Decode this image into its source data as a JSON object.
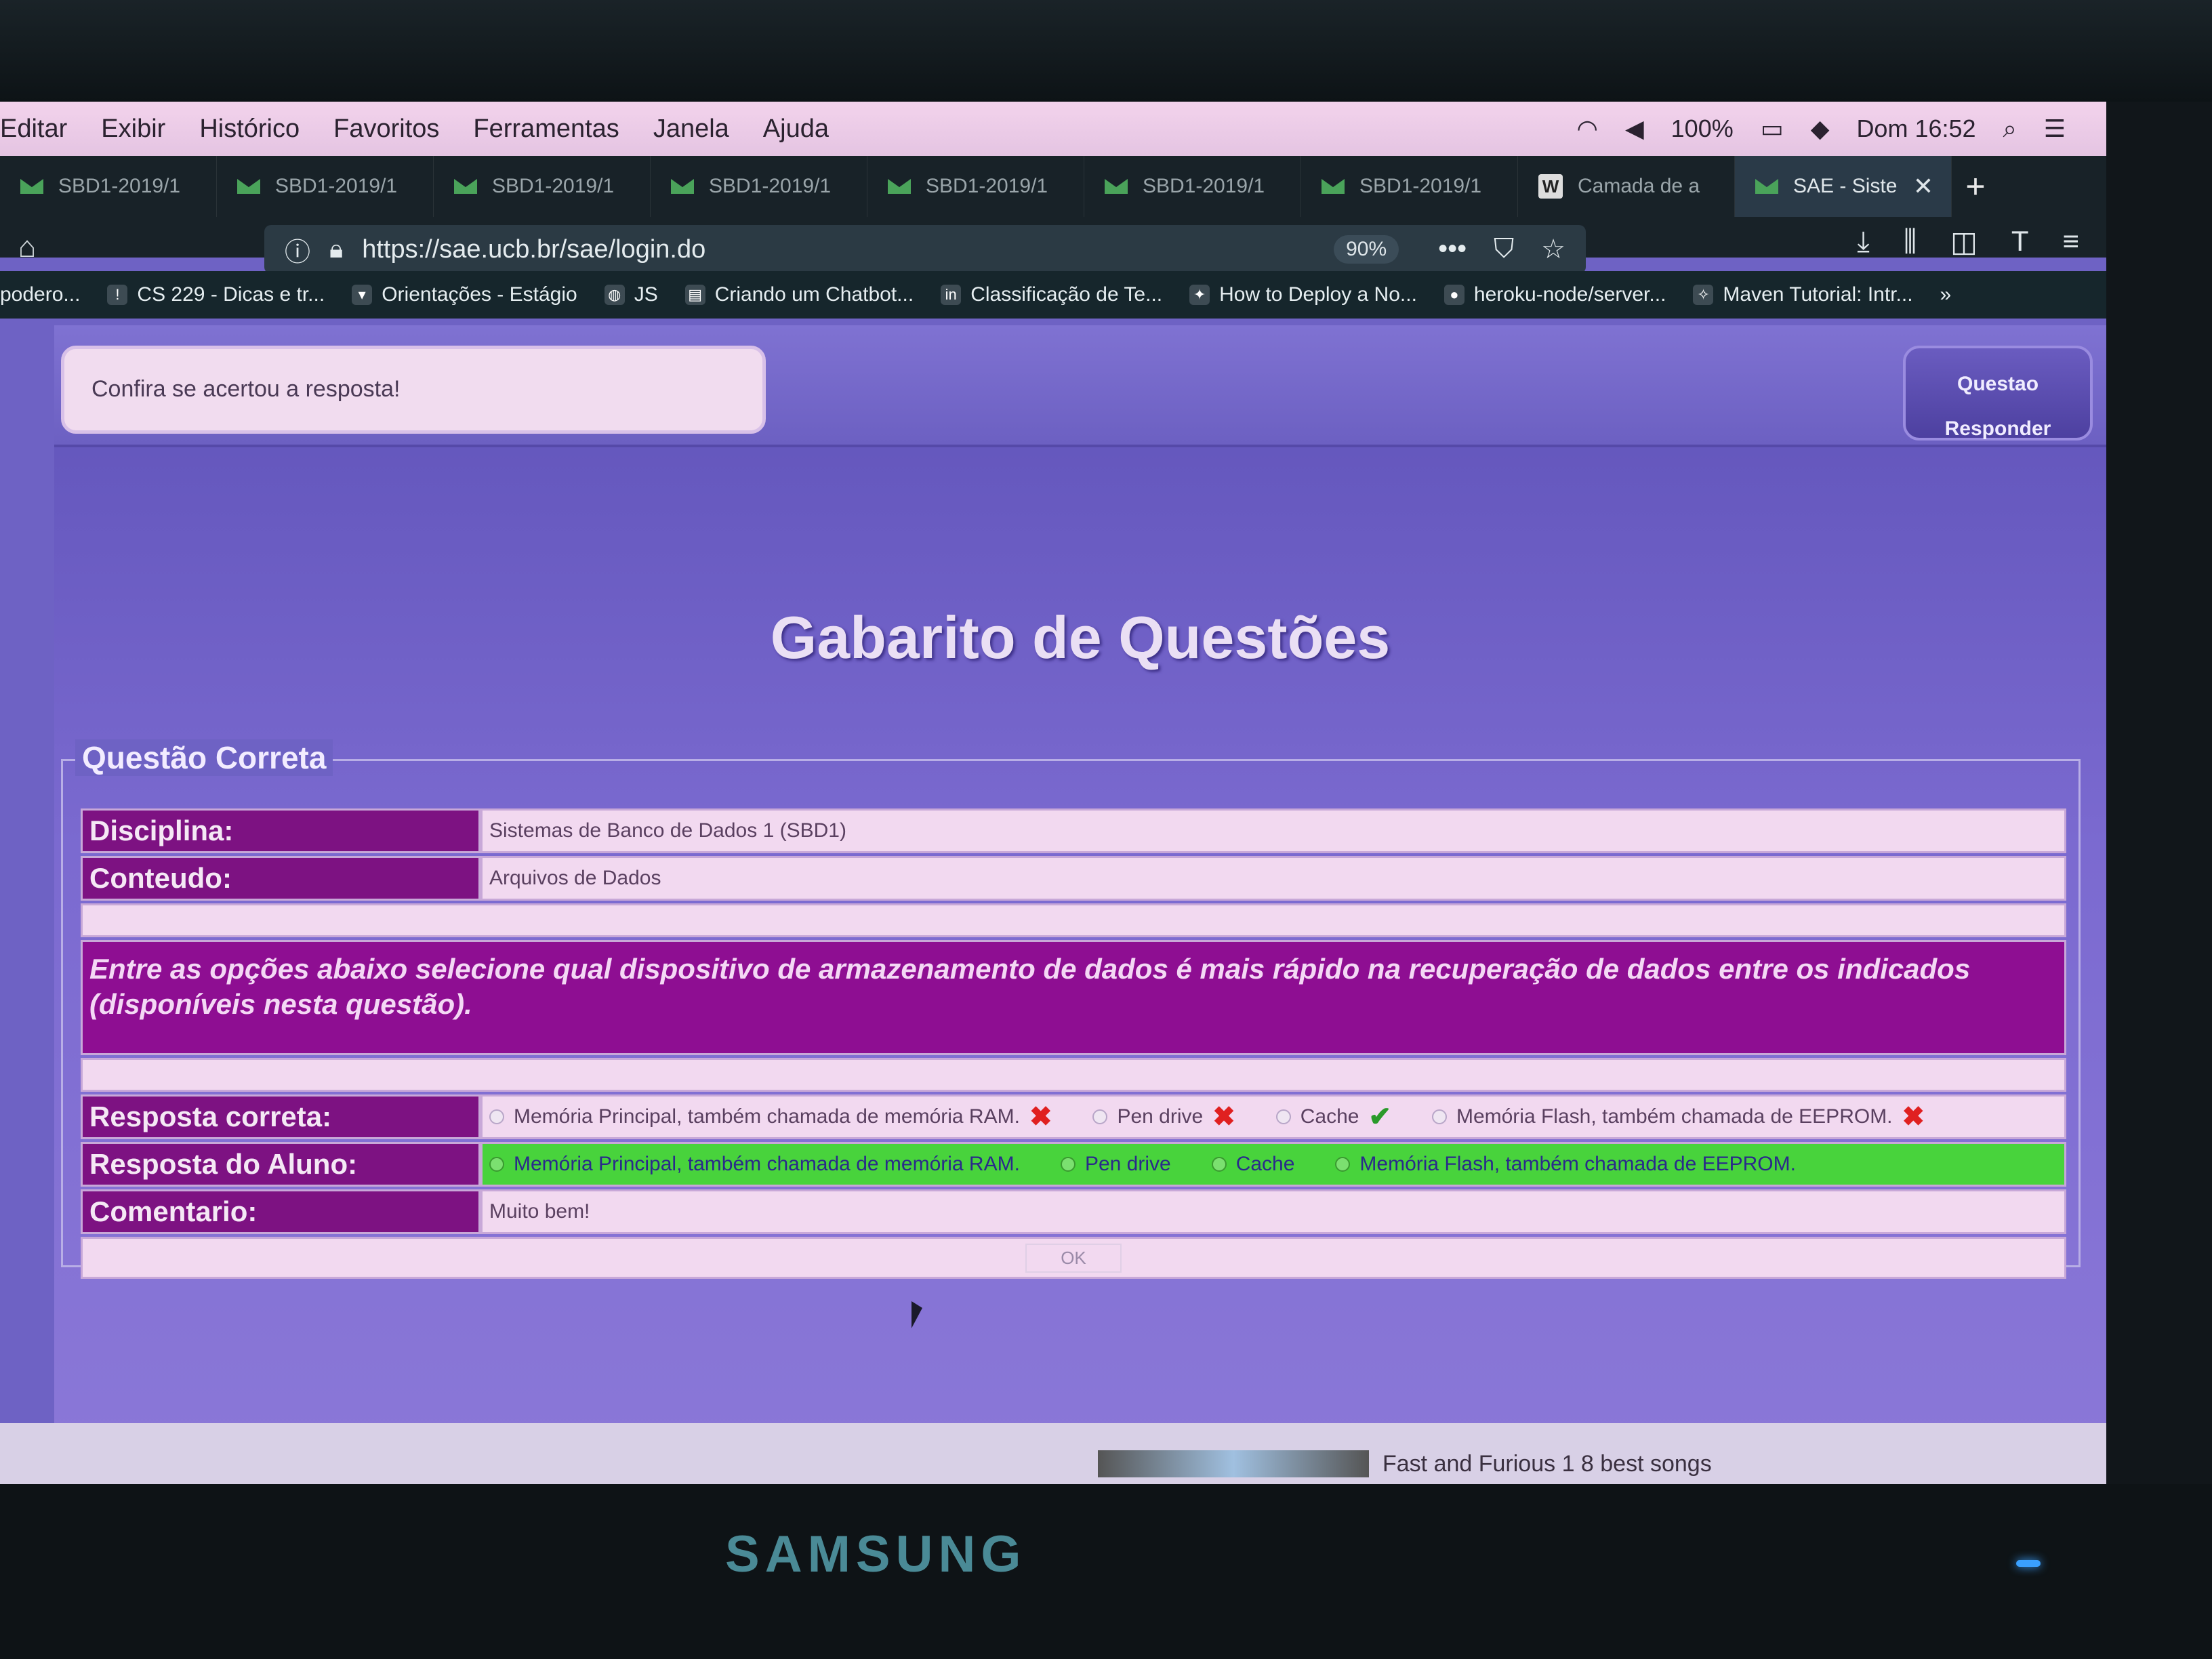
{
  "menubar": {
    "items": [
      "Editar",
      "Exibir",
      "Histórico",
      "Favoritos",
      "Ferramentas",
      "Janela",
      "Ajuda"
    ],
    "battery": "100%",
    "clock": "Dom 16:52"
  },
  "tabs": [
    {
      "label": "SBD1-2019/1",
      "icon": "gmail-icon"
    },
    {
      "label": "SBD1-2019/1",
      "icon": "gmail-icon"
    },
    {
      "label": "SBD1-2019/1",
      "icon": "gmail-icon"
    },
    {
      "label": "SBD1-2019/1",
      "icon": "gmail-icon"
    },
    {
      "label": "SBD1-2019/1",
      "icon": "gmail-icon"
    },
    {
      "label": "SBD1-2019/1",
      "icon": "gmail-icon"
    },
    {
      "label": "SBD1-2019/1",
      "icon": "gmail-icon"
    },
    {
      "label": "Camada de a",
      "icon": "wordpress-icon"
    },
    {
      "label": "SAE - Siste",
      "icon": "sae-icon",
      "active": true
    }
  ],
  "url": {
    "value": "https://sae.ucb.br/sae/login.do",
    "zoom": "90%"
  },
  "bookmarks": [
    "podero...",
    "CS 229 - Dicas e tr...",
    "Orientações - Estágio",
    "JS",
    "Criando um Chatbot...",
    "Classificação de Te...",
    "How to Deploy a No...",
    "heroku-node/server...",
    "Maven Tutorial: Intr..."
  ],
  "page": {
    "message": "Confira se acertou a resposta!",
    "questao_btn_line1": "Questao",
    "questao_btn_line2": "Responder",
    "title": "Gabarito de Questões",
    "legend": "Questão Correta",
    "disciplina_label": "Disciplina:",
    "disciplina_value": "Sistemas de Banco de Dados 1 (SBD1)",
    "conteudo_label": "Conteudo:",
    "conteudo_value": "Arquivos de Dados",
    "question": "Entre as opções abaixo selecione qual dispositivo de armazenamento de dados é mais rápido na recuperação de dados entre os indicados (disponíveis nesta questão).",
    "correta_label": "Resposta correta:",
    "correta_options": [
      {
        "label": "Memória Principal, também chamada de memória RAM.",
        "mark": "x"
      },
      {
        "label": "Pen drive",
        "mark": "x"
      },
      {
        "label": "Cache",
        "mark": "check"
      },
      {
        "label": "Memória Flash, também chamada de EEPROM.",
        "mark": "x"
      }
    ],
    "aluno_label": "Resposta do Aluno:",
    "aluno_options": [
      "Memória Principal, também chamada de memória RAM.",
      "Pen drive",
      "Cache",
      "Memória Flash, também chamada de EEPROM."
    ],
    "comentario_label": "Comentario:",
    "comentario_value": "Muito bem!",
    "ok_label": "OK"
  },
  "taskbar": {
    "item": "Fast and Furious 1 8 best songs"
  },
  "monitor": {
    "brand": "SAMSUNG"
  }
}
